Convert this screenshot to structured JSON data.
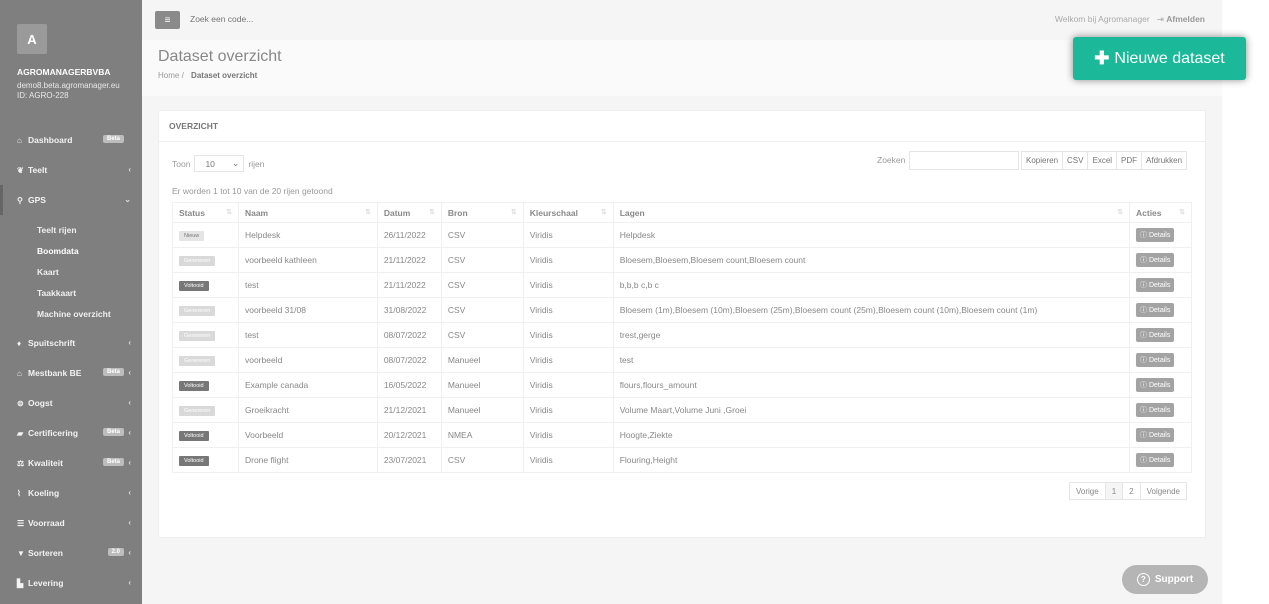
{
  "sidebar": {
    "avatar_letter": "A",
    "company": "AGROMANAGERBVBA",
    "domain": "demo8.beta.agromanager.eu",
    "id": "ID: AGRO-228",
    "items": [
      {
        "label": "Dashboard",
        "icon": "home-icon",
        "glyph": "⌂",
        "badge": "Beta",
        "chevron": ""
      },
      {
        "label": "Teelt",
        "icon": "leaf-icon",
        "glyph": "❦",
        "badge": "",
        "chevron": "‹"
      },
      {
        "label": "GPS",
        "icon": "map-marker-icon",
        "glyph": "⚲",
        "badge": "",
        "chevron": "⌄"
      },
      {
        "label": "Spuitschrift",
        "icon": "drop-icon",
        "glyph": "♦",
        "badge": "",
        "chevron": "‹"
      },
      {
        "label": "Mestbank BE",
        "icon": "bank-icon",
        "glyph": "⌂",
        "badge": "Beta",
        "chevron": "‹"
      },
      {
        "label": "Oogst",
        "icon": "basket-icon",
        "glyph": "⊜",
        "badge": "",
        "chevron": "‹"
      },
      {
        "label": "Certificering",
        "icon": "certificate-icon",
        "glyph": "▰",
        "badge": "Beta",
        "chevron": "‹"
      },
      {
        "label": "Kwaliteit",
        "icon": "balance-icon",
        "glyph": "⚖",
        "badge": "Beta",
        "chevron": "‹"
      },
      {
        "label": "Koeling",
        "icon": "thermometer-icon",
        "glyph": "⌇",
        "badge": "",
        "chevron": "‹"
      },
      {
        "label": "Voorraad",
        "icon": "list-icon",
        "glyph": "☰",
        "badge": "",
        "chevron": "‹"
      },
      {
        "label": "Sorteren",
        "icon": "filter-icon",
        "glyph": "▼",
        "badge": "2.0",
        "chevron": "‹"
      },
      {
        "label": "Levering",
        "icon": "truck-icon",
        "glyph": "▙",
        "badge": "",
        "chevron": "‹"
      }
    ],
    "gps_sub": [
      "Teelt rijen",
      "Boomdata",
      "Kaart",
      "Taakkaart",
      "Machine overzicht"
    ]
  },
  "topbar": {
    "search_placeholder": "Zoek een code...",
    "welcome": "Welkom bij Agromanager",
    "logout": "Afmelden"
  },
  "header": {
    "title": "Dataset overzicht",
    "crumb_home": "Home",
    "crumb_sep": "/",
    "crumb_current": "Dataset overzicht",
    "new_button": "Nieuwe dataset"
  },
  "panel": {
    "title": "OVERZICHT",
    "show_label": "Toon",
    "show_value": "10",
    "rows_label": "rijen",
    "search_label": "Zoeken",
    "export": [
      "Kopieren",
      "CSV",
      "Excel",
      "PDF",
      "Afdrukken"
    ],
    "info": "Er worden 1 tot 10 van de 20 rijen getoond",
    "columns": [
      "Status",
      "Naam",
      "Datum",
      "Bron",
      "Kleurschaal",
      "Lagen",
      "Acties"
    ],
    "details_label": "Details",
    "rows": [
      {
        "status": "Nieuw",
        "kind": "nieuw",
        "naam": "Helpdesk",
        "datum": "26/11/2022",
        "bron": "CSV",
        "kleur": "Viridis",
        "lagen": "Helpdesk"
      },
      {
        "status": "Genereren",
        "kind": "gen",
        "naam": "voorbeeld kathleen",
        "datum": "21/11/2022",
        "bron": "CSV",
        "kleur": "Viridis",
        "lagen": "Bloesem,Bloesem,Bloesem count,Bloesem count"
      },
      {
        "status": "Voltooid",
        "kind": "vol",
        "naam": "test",
        "datum": "21/11/2022",
        "bron": "CSV",
        "kleur": "Viridis",
        "lagen": "b,b,b c,b c"
      },
      {
        "status": "Genereren",
        "kind": "gen",
        "naam": "voorbeeld 31/08",
        "datum": "31/08/2022",
        "bron": "CSV",
        "kleur": "Viridis",
        "lagen": "Bloesem (1m),Bloesem (10m),Bloesem (25m),Bloesem count (25m),Bloesem count (10m),Bloesem count (1m)"
      },
      {
        "status": "Genereren",
        "kind": "gen",
        "naam": "test",
        "datum": "08/07/2022",
        "bron": "CSV",
        "kleur": "Viridis",
        "lagen": "trest,gerge"
      },
      {
        "status": "Genereren",
        "kind": "gen",
        "naam": "voorbeeld",
        "datum": "08/07/2022",
        "bron": "Manueel",
        "kleur": "Viridis",
        "lagen": "test"
      },
      {
        "status": "Voltooid",
        "kind": "vol",
        "naam": "Example canada",
        "datum": "16/05/2022",
        "bron": "Manueel",
        "kleur": "Viridis",
        "lagen": "flours,flours_amount"
      },
      {
        "status": "Genereren",
        "kind": "gen",
        "naam": "Groeikracht",
        "datum": "21/12/2021",
        "bron": "Manueel",
        "kleur": "Viridis",
        "lagen": "Volume Maart,Volume Juni ,Groei"
      },
      {
        "status": "Voltooid",
        "kind": "vol",
        "naam": "Voorbeeld",
        "datum": "20/12/2021",
        "bron": "NMEA",
        "kleur": "Viridis",
        "lagen": "Hoogte,Ziekte"
      },
      {
        "status": "Voltooid",
        "kind": "vol",
        "naam": "Drone flight",
        "datum": "23/07/2021",
        "bron": "CSV",
        "kleur": "Viridis",
        "lagen": "Flouring,Height"
      }
    ],
    "pager": [
      "Vorige",
      "1",
      "2",
      "Volgende"
    ]
  },
  "support": "Support"
}
